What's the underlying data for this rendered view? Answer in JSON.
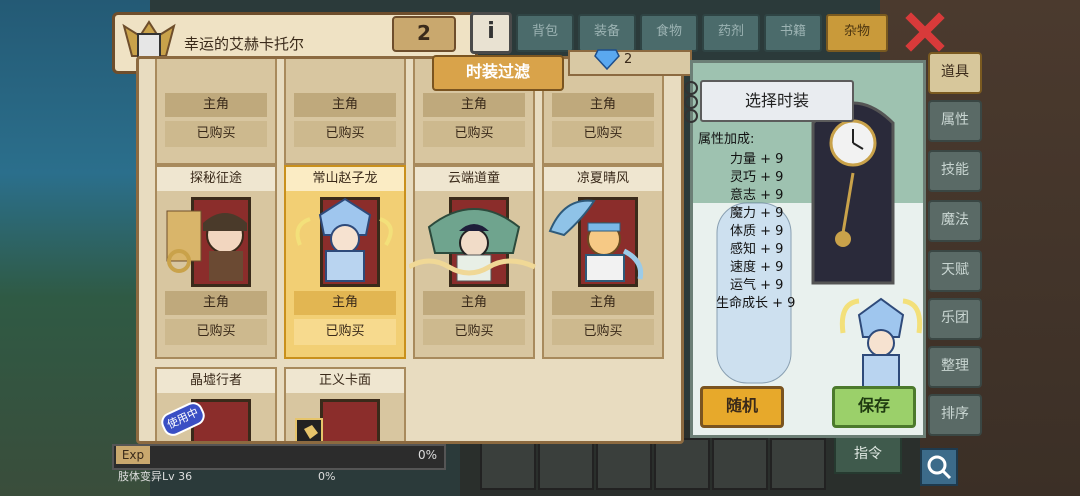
{
  "character": {
    "name": "幸运的艾赫卡托尔",
    "level": "2"
  },
  "tabs": [
    {
      "label": "背包",
      "active": false
    },
    {
      "label": "装备",
      "active": false
    },
    {
      "label": "食物",
      "active": false
    },
    {
      "label": "药剂",
      "active": false
    },
    {
      "label": "书籍",
      "active": false
    },
    {
      "label": "杂物",
      "active": true
    }
  ],
  "sidebar": [
    "道具",
    "属性",
    "技能",
    "魔法",
    "天赋",
    "乐团",
    "整理",
    "排序"
  ],
  "modal": {
    "title": "时装过滤",
    "gems": "2"
  },
  "cards_top": [
    {
      "role": "主角",
      "status": "已购买"
    },
    {
      "role": "主角",
      "status": "已购买"
    },
    {
      "role": "主角",
      "status": "已购买"
    },
    {
      "role": "主角",
      "status": "已购买"
    }
  ],
  "cards_mid": [
    {
      "name": "探秘征途",
      "role": "主角",
      "status": "已购买",
      "selected": false
    },
    {
      "name": "常山赵子龙",
      "role": "主角",
      "status": "已购买",
      "selected": true
    },
    {
      "name": "云端道童",
      "role": "主角",
      "status": "已购买",
      "selected": false
    },
    {
      "name": "凉夏晴风",
      "role": "主角",
      "status": "已购买",
      "selected": false
    }
  ],
  "cards_bottom": [
    {
      "name": "晶墟行者",
      "badge": "使用中"
    },
    {
      "name": "正义卡面"
    }
  ],
  "preview": {
    "title": "选择时装",
    "attr_title": "属性加成:",
    "attrs": [
      "力量 + 9",
      "灵巧 + 9",
      "意志 + 9",
      "魔力 + 9",
      "体质 + 9",
      "感知 + 9",
      "速度 + 9",
      "运气 + 9",
      "生命成长 + 9"
    ],
    "random_label": "随机",
    "save_label": "保存"
  },
  "exp": {
    "label": "Exp",
    "percent": "0%",
    "skill": "肢体变异Lv 36",
    "skill_percent": "0%"
  },
  "command_label": "指令"
}
